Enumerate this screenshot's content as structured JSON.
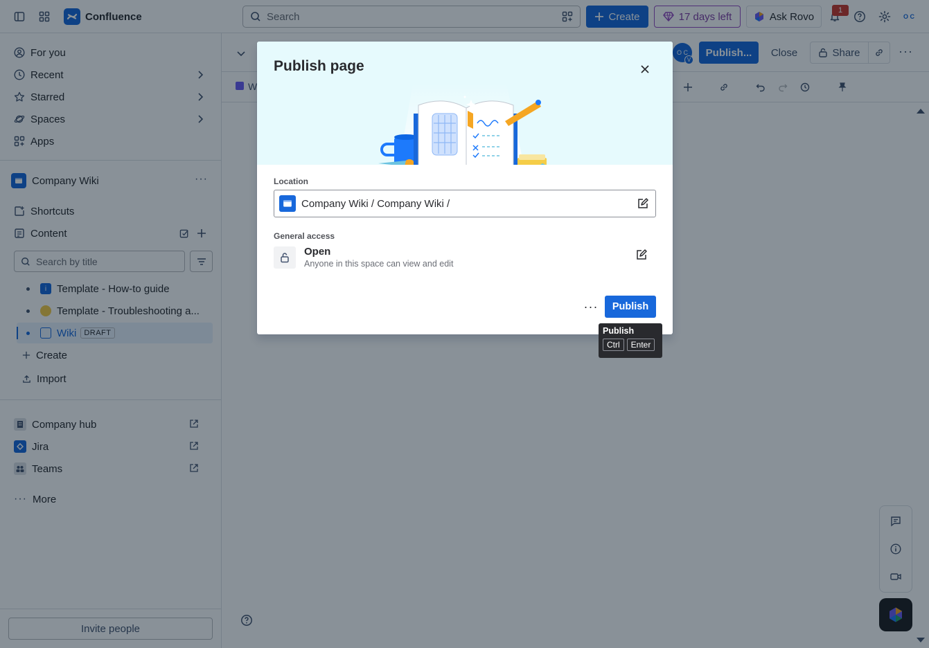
{
  "app": {
    "name": "Confluence",
    "search_placeholder": "Search",
    "create_label": "Create",
    "trial_label": "17 days left",
    "rovo_label": "Ask Rovo",
    "notification_count": "1",
    "user_initials": "O C"
  },
  "sidebar": {
    "nav": [
      {
        "label": "For you",
        "icon": "person-circle-icon"
      },
      {
        "label": "Recent",
        "icon": "clock-icon"
      },
      {
        "label": "Starred",
        "icon": "star-icon"
      },
      {
        "label": "Spaces",
        "icon": "planet-icon"
      },
      {
        "label": "Apps",
        "icon": "apps-icon"
      }
    ],
    "space_name": "Company Wiki",
    "shortcuts_label": "Shortcuts",
    "content_label": "Content",
    "search_placeholder": "Search by title",
    "tree": [
      {
        "label": "Template - How-to guide",
        "icon": "info-page-icon"
      },
      {
        "label": "Template - Troubleshooting a...",
        "icon": "emoji-page-icon"
      },
      {
        "label": "Wiki",
        "tag": "DRAFT",
        "icon": "page-icon"
      }
    ],
    "create_label": "Create",
    "import_label": "Import",
    "links": [
      {
        "label": "Company hub",
        "icon": "building-icon"
      },
      {
        "label": "Jira",
        "icon": "jira-icon"
      },
      {
        "label": "Teams",
        "icon": "teams-icon"
      }
    ],
    "more_label": "More",
    "invite_label": "Invite people"
  },
  "page": {
    "publish_label": "Publish...",
    "close_label": "Close",
    "share_label": "Share",
    "breadcrumb_initial": "W",
    "avatar_initials": "O C",
    "avatar_sub": "V"
  },
  "modal": {
    "title": "Publish page",
    "location_label": "Location",
    "location_value": "Company Wiki / Company Wiki /",
    "access_label": "General access",
    "access_title": "Open",
    "access_desc": "Anyone in this space can view and edit",
    "publish_label": "Publish"
  },
  "tooltip": {
    "title": "Publish",
    "keys": [
      "Ctrl",
      "Enter"
    ]
  },
  "colors": {
    "brand": "#1868db",
    "trial": "#964ac0",
    "hero_bg": "#e6fafd"
  }
}
